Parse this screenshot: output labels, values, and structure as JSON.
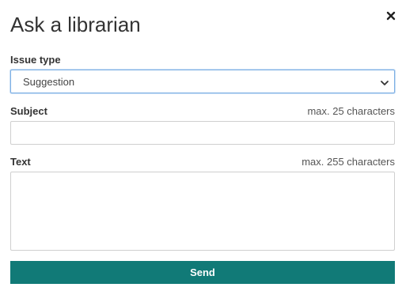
{
  "dialog": {
    "title": "Ask a librarian",
    "close_icon": "close-icon"
  },
  "form": {
    "issue_type": {
      "label": "Issue type",
      "selected": "Suggestion",
      "icon": "chevron-down-icon"
    },
    "subject": {
      "label": "Subject",
      "hint": "max. 25 characters",
      "value": ""
    },
    "text": {
      "label": "Text",
      "hint": "max. 255 characters",
      "value": ""
    },
    "send_label": "Send"
  },
  "colors": {
    "accent": "#117a77",
    "focus_border": "#7fb0e4"
  }
}
